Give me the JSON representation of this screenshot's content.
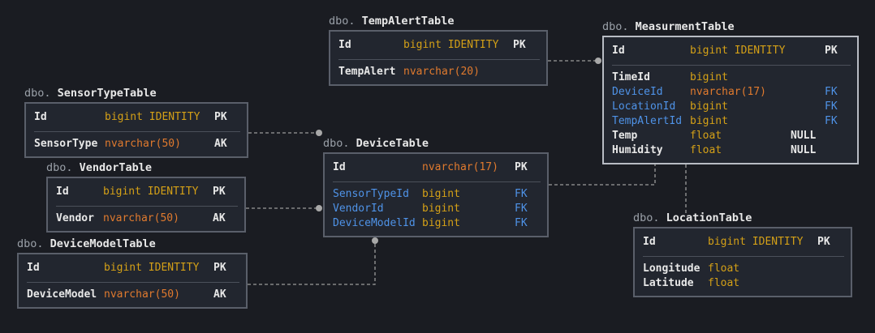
{
  "colors": {
    "background": "#1a1c22",
    "table_bg": "#22262f",
    "border": "#5a5f6a",
    "selected_border": "#b8bcc4",
    "name": "#e8e8e8",
    "fk_name": "#4f93e8",
    "type_numeric": "#d4a017",
    "type_string": "#e07a2e",
    "connector": "#9a9a9a"
  },
  "tables": {
    "temp_alert": {
      "schema": "dbo.",
      "name": "TempAlertTable",
      "pk": {
        "name": "Id",
        "type": "bigint IDENTITY",
        "key": "PK"
      },
      "columns": [
        {
          "name": "TempAlert",
          "type": "nvarchar(20)",
          "key": ""
        }
      ]
    },
    "measurement": {
      "schema": "dbo.",
      "name": "MeasurmentTable",
      "pk": {
        "name": "Id",
        "type": "bigint IDENTITY",
        "key": "PK"
      },
      "columns": [
        {
          "name": "TimeId",
          "type": "bigint",
          "null": "",
          "key": ""
        },
        {
          "name": "DeviceId",
          "type": "nvarchar(17)",
          "null": "",
          "key": "FK"
        },
        {
          "name": "LocationId",
          "type": "bigint",
          "null": "",
          "key": "FK"
        },
        {
          "name": "TempAlertId",
          "type": "bigint",
          "null": "",
          "key": "FK"
        },
        {
          "name": "Temp",
          "type": "float",
          "null": "NULL",
          "key": ""
        },
        {
          "name": "Humidity",
          "type": "float",
          "null": "NULL",
          "key": ""
        }
      ]
    },
    "sensor_type": {
      "schema": "dbo.",
      "name": "SensorTypeTable",
      "pk": {
        "name": "Id",
        "type": "bigint IDENTITY",
        "key": "PK"
      },
      "columns": [
        {
          "name": "SensorType",
          "type": "nvarchar(50)",
          "key": "AK"
        }
      ]
    },
    "vendor": {
      "schema": "dbo.",
      "name": "VendorTable",
      "pk": {
        "name": "Id",
        "type": "bigint IDENTITY",
        "key": "PK"
      },
      "columns": [
        {
          "name": "Vendor",
          "type": "nvarchar(50)",
          "key": "AK"
        }
      ]
    },
    "device_model": {
      "schema": "dbo.",
      "name": "DeviceModelTable",
      "pk": {
        "name": "Id",
        "type": "bigint IDENTITY",
        "key": "PK"
      },
      "columns": [
        {
          "name": "DeviceModel",
          "type": "nvarchar(50)",
          "key": "AK"
        }
      ]
    },
    "device": {
      "schema": "dbo.",
      "name": "DeviceTable",
      "pk": {
        "name": "Id",
        "type": "nvarchar(17)",
        "key": "PK"
      },
      "columns": [
        {
          "name": "SensorTypeId",
          "type": "bigint",
          "key": "FK"
        },
        {
          "name": "VendorId",
          "type": "bigint",
          "key": "FK"
        },
        {
          "name": "DeviceModelId",
          "type": "bigint",
          "key": "FK"
        }
      ]
    },
    "location": {
      "schema": "dbo.",
      "name": "LocationTable",
      "pk": {
        "name": "Id",
        "type": "bigint IDENTITY",
        "key": "PK"
      },
      "columns": [
        {
          "name": "Longitude",
          "type": "float",
          "key": ""
        },
        {
          "name": "Latitude",
          "type": "float",
          "key": ""
        }
      ]
    }
  },
  "relationships": [
    {
      "from": "temp_alert",
      "to": "measurement"
    },
    {
      "from": "sensor_type",
      "to": "device"
    },
    {
      "from": "vendor",
      "to": "device"
    },
    {
      "from": "device_model",
      "to": "device"
    },
    {
      "from": "device",
      "to": "measurement"
    },
    {
      "from": "location",
      "to": "measurement"
    }
  ]
}
